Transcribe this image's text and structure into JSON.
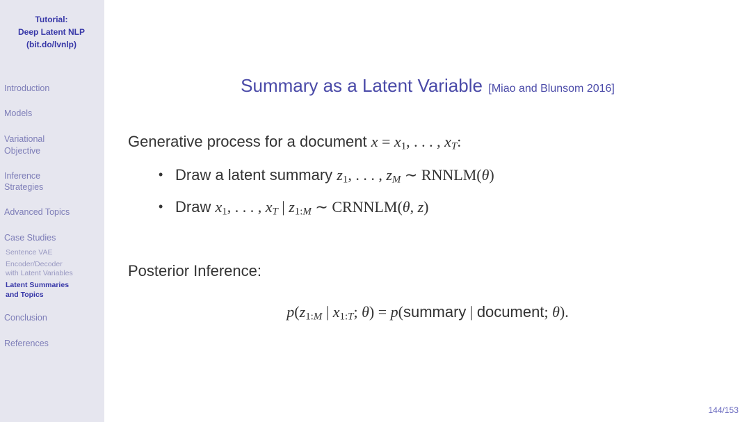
{
  "sidebar": {
    "title_line1": "Tutorial:",
    "title_line2": "Deep Latent NLP",
    "title_line3": "(bit.do/lvnlp)",
    "nav": {
      "intro": "Introduction",
      "models": "Models",
      "varobj_l1": "Variational",
      "varobj_l2": "Objective",
      "inf_l1": "Inference",
      "inf_l2": "Strategies",
      "advanced": "Advanced Topics",
      "casestudies": "Case Studies",
      "sub_sentvae": "Sentence VAE",
      "sub_encdec_l1": "Encoder/Decoder",
      "sub_encdec_l2": "with Latent Variables",
      "sub_latsum_l1": "Latent Summaries",
      "sub_latsum_l2": "and Topics",
      "conclusion": "Conclusion",
      "references": "References"
    }
  },
  "slide": {
    "title": "Summary as a Latent Variable",
    "citation": "[Miao and Blunsom 2016]",
    "intro_prefix": "Generative process for a document ",
    "m": {
      "x": "x",
      "eq": " = ",
      "x1": "x",
      "one": "1",
      "comma": ", . . . , ",
      "xT": "x",
      "T": "T",
      "colon": ":",
      "z": "z",
      "M": "M",
      "tilde": " ∼ ",
      "rnnlm": "RNNLM",
      "crnnlm": "CRNNLM",
      "lp": "(",
      "rp": ")",
      "theta": "θ",
      "c2": ", ",
      "bar": " | ",
      "oneM": "1:",
      "oneT": "1:",
      "p": "p",
      "semi": "; ",
      "dot": "."
    },
    "bullet1_prefix": "Draw a latent summary ",
    "bullet2_prefix": "Draw ",
    "posterior_label": "Posterior Inference:",
    "eq_summary": "summary",
    "eq_document": "document",
    "page_number": "144/153"
  }
}
